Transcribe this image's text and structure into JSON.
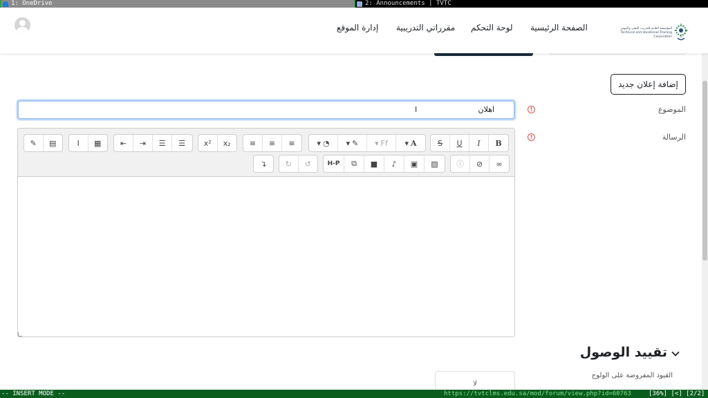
{
  "tabs": [
    {
      "number_label": "1: OneDrive"
    },
    {
      "number_label": "2: Announcements | TVTC"
    }
  ],
  "navbar": {
    "links": [
      "الصفحة الرئيسية",
      "لوحة التحكم",
      "مقرراتي التدريبية",
      "إدارة الموقع"
    ],
    "logo_line1": "المؤسسة العامة للتدريب التقني والمهني",
    "logo_line2": "Technical and Vocational Training Corporation"
  },
  "actions": {
    "add_announcement": "إضافة إعلان جديد"
  },
  "form": {
    "subject_label": "الموضوع",
    "subject_value": "اهلان",
    "message_label": "الرسالة",
    "required_symbol": "!"
  },
  "editor": {
    "row1": [
      {
        "icon": "bold-icon",
        "glyph": "B"
      },
      {
        "icon": "italic-icon",
        "glyph": "I"
      },
      {
        "icon": "underline-icon",
        "glyph": "U"
      },
      {
        "icon": "strikethrough-icon",
        "glyph": "S"
      },
      {
        "icon": "font-size-icon",
        "glyph": "A"
      },
      {
        "icon": "font-family-icon",
        "glyph": "Ff"
      },
      {
        "icon": "paint-brush-icon",
        "glyph": "🖌"
      },
      {
        "icon": "highlight-icon",
        "glyph": "💡"
      },
      {
        "icon": "align-left-icon",
        "glyph": "≡"
      },
      {
        "icon": "align-center-icon",
        "glyph": "≡"
      },
      {
        "icon": "align-right-icon",
        "glyph": "≡"
      },
      {
        "icon": "subscript-icon",
        "glyph": "x₂"
      },
      {
        "icon": "superscript-icon",
        "glyph": "x²"
      },
      {
        "icon": "bullet-list-icon",
        "glyph": "☰"
      },
      {
        "icon": "numbered-list-icon",
        "glyph": "☰"
      },
      {
        "icon": "outdent-icon",
        "glyph": "⇤"
      },
      {
        "icon": "indent-icon",
        "glyph": "⇥"
      },
      {
        "icon": "table-icon",
        "glyph": "▦"
      },
      {
        "icon": "text-cursor-icon",
        "glyph": "I"
      },
      {
        "icon": "calculator-icon",
        "glyph": "▤"
      },
      {
        "icon": "edit-icon",
        "glyph": "✎"
      }
    ],
    "row2": [
      {
        "icon": "link-icon",
        "glyph": "🔗"
      },
      {
        "icon": "unlink-icon",
        "glyph": "⛓"
      },
      {
        "icon": "warning-icon",
        "glyph": "ⓘ"
      },
      {
        "icon": "image-icon",
        "glyph": "🖼"
      },
      {
        "icon": "media-file-icon",
        "glyph": "▣"
      },
      {
        "icon": "microphone-icon",
        "glyph": "🎙"
      },
      {
        "icon": "video-camera-icon",
        "glyph": "▶"
      },
      {
        "icon": "copy-icon",
        "glyph": "⧉"
      },
      {
        "icon": "h5p-icon",
        "glyph": "H-P"
      },
      {
        "icon": "undo-icon",
        "glyph": "↺"
      },
      {
        "icon": "redo-icon",
        "glyph": "↻"
      },
      {
        "icon": "expand-toolbar-icon",
        "glyph": "↴"
      }
    ]
  },
  "restrict": {
    "title": "تقييد الوصول",
    "sub_label": "القيود المفروضة على الولوج",
    "value": "لا"
  },
  "statusbar": {
    "mode": "-- INSERT MODE --",
    "url": "https://tvtclms.edu.sa/mod/forum/view.php?id=60763",
    "position": "[36%] [<] [2/2]"
  }
}
